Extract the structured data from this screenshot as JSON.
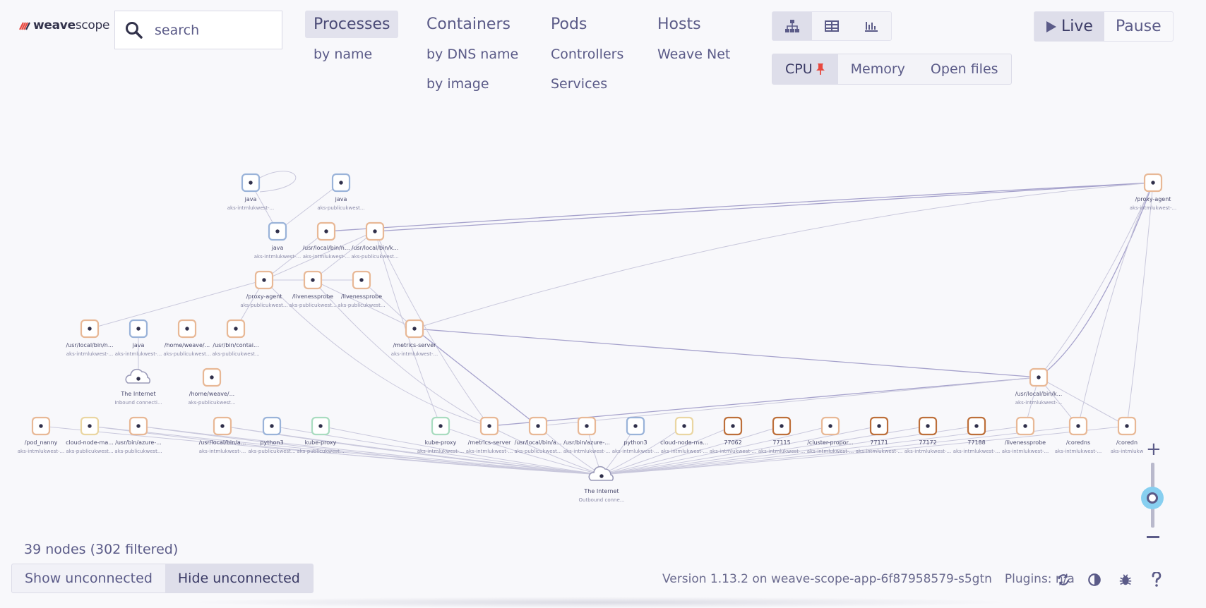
{
  "logo": {
    "bold": "weave",
    "light": "scope"
  },
  "search": {
    "placeholder": "search"
  },
  "nav": [
    {
      "label": "Processes",
      "subs": [
        "by name"
      ]
    },
    {
      "label": "Containers",
      "subs": [
        "by DNS name",
        "by image"
      ]
    },
    {
      "label": "Pods",
      "subs": [
        "Controllers",
        "Services"
      ]
    },
    {
      "label": "Hosts",
      "subs": [
        "Weave Net"
      ]
    }
  ],
  "views": [
    {
      "name": "graph-view",
      "icon": "hierarchy-icon"
    },
    {
      "name": "table-view",
      "icon": "table-icon"
    },
    {
      "name": "resource-view",
      "icon": "bar-chart-icon"
    }
  ],
  "metrics": [
    "CPU",
    "Memory",
    "Open files"
  ],
  "live": {
    "live": "Live",
    "pause": "Pause"
  },
  "graph_nodes": [
    {
      "label": "java",
      "sub": "aks-intmlukwest-..."
    },
    {
      "label": "java",
      "sub": "aks-publicukwest..."
    },
    {
      "label": "java",
      "sub": "aks-intmlukwest-..."
    },
    {
      "label": "/usr/local/bin/n...",
      "sub": "aks-intmlukwest-..."
    },
    {
      "label": "/usr/local/bin/k...",
      "sub": "aks-publicukwest..."
    },
    {
      "label": "/proxy-agent",
      "sub": "aks-intmlukwest-..."
    },
    {
      "label": "/proxy-agent",
      "sub": "aks-publicukwest..."
    },
    {
      "label": "/livenessprobe",
      "sub": "aks-publicukwest..."
    },
    {
      "label": "/livenessprobe",
      "sub": "aks-publicukwest..."
    },
    {
      "label": "/usr/local/bin/n...",
      "sub": "aks-intmlukwest-..."
    },
    {
      "label": "java",
      "sub": "aks-intmlukwest-..."
    },
    {
      "label": "/home/weave/...",
      "sub": "aks-publicukwest..."
    },
    {
      "label": "/usr/bin/contai...",
      "sub": "aks-publicukwest..."
    },
    {
      "label": "/metrics-server",
      "sub": "aks-intmlukwest-..."
    },
    {
      "label": "The Internet",
      "sub": "Inbound connecti..."
    },
    {
      "label": "/home/weave/...",
      "sub": "aks-publicukwest..."
    },
    {
      "label": "/usr/local/bin/k...",
      "sub": "aks-intmlukwest-..."
    },
    {
      "label": "/pod_nanny",
      "sub": "aks-intmlukwest-..."
    },
    {
      "label": "cloud-node-ma...",
      "sub": "aks-publicukwest..."
    },
    {
      "label": "/usr/bin/azure-...",
      "sub": "aks-publicukwest..."
    },
    {
      "label": "/usr/local/bin/a...",
      "sub": "aks-intmlukwest-..."
    },
    {
      "label": "python3",
      "sub": "aks-publicukwest..."
    },
    {
      "label": "kube-proxy",
      "sub": "aks-publicukwest..."
    },
    {
      "label": "kube-proxy",
      "sub": "aks-intmlukwest-..."
    },
    {
      "label": "/metrics-server",
      "sub": "aks-intmlukwest-..."
    },
    {
      "label": "/usr/local/bin/a...",
      "sub": "aks-publicukwest..."
    },
    {
      "label": "/usr/bin/azure-...",
      "sub": "aks-intmlukwest-..."
    },
    {
      "label": "python3",
      "sub": "aks-intmlukwest-..."
    },
    {
      "label": "cloud-node-ma...",
      "sub": "aks-intmlukwest-..."
    },
    {
      "label": "77062",
      "sub": "aks-intmlukwest-..."
    },
    {
      "label": "77115",
      "sub": "aks-intmlukwest-..."
    },
    {
      "label": "/cluster-propor...",
      "sub": "aks-intmlukwest-..."
    },
    {
      "label": "77171",
      "sub": "aks-intmlukwest-..."
    },
    {
      "label": "77172",
      "sub": "aks-intmlukwest-..."
    },
    {
      "label": "77188",
      "sub": "aks-intmlukwest-..."
    },
    {
      "label": "/livenessprobe",
      "sub": "aks-intmlukwest-..."
    },
    {
      "label": "/coredns",
      "sub": "aks-intmlukwest-..."
    },
    {
      "label": "/coredn",
      "sub": "aks-intmlukw"
    },
    {
      "label": "The Internet",
      "sub": "Outbound conne..."
    }
  ],
  "status": {
    "nodes": "39 nodes (302 filtered)"
  },
  "unconnected": {
    "show": "Show unconnected",
    "hide": "Hide unconnected"
  },
  "footer": {
    "version": "Version 1.13.2 on weave-scope-app-6f87958579-s5gtn",
    "plugins": "Plugins: n/a"
  },
  "footer_icons": [
    "refresh-icon",
    "contrast-icon",
    "bug-icon",
    "help-icon"
  ],
  "colors": {
    "accent": "#5b5b88",
    "active_bg": "#dedeea",
    "zoom_handle": "#87cff0",
    "pin": "#e8483f"
  }
}
